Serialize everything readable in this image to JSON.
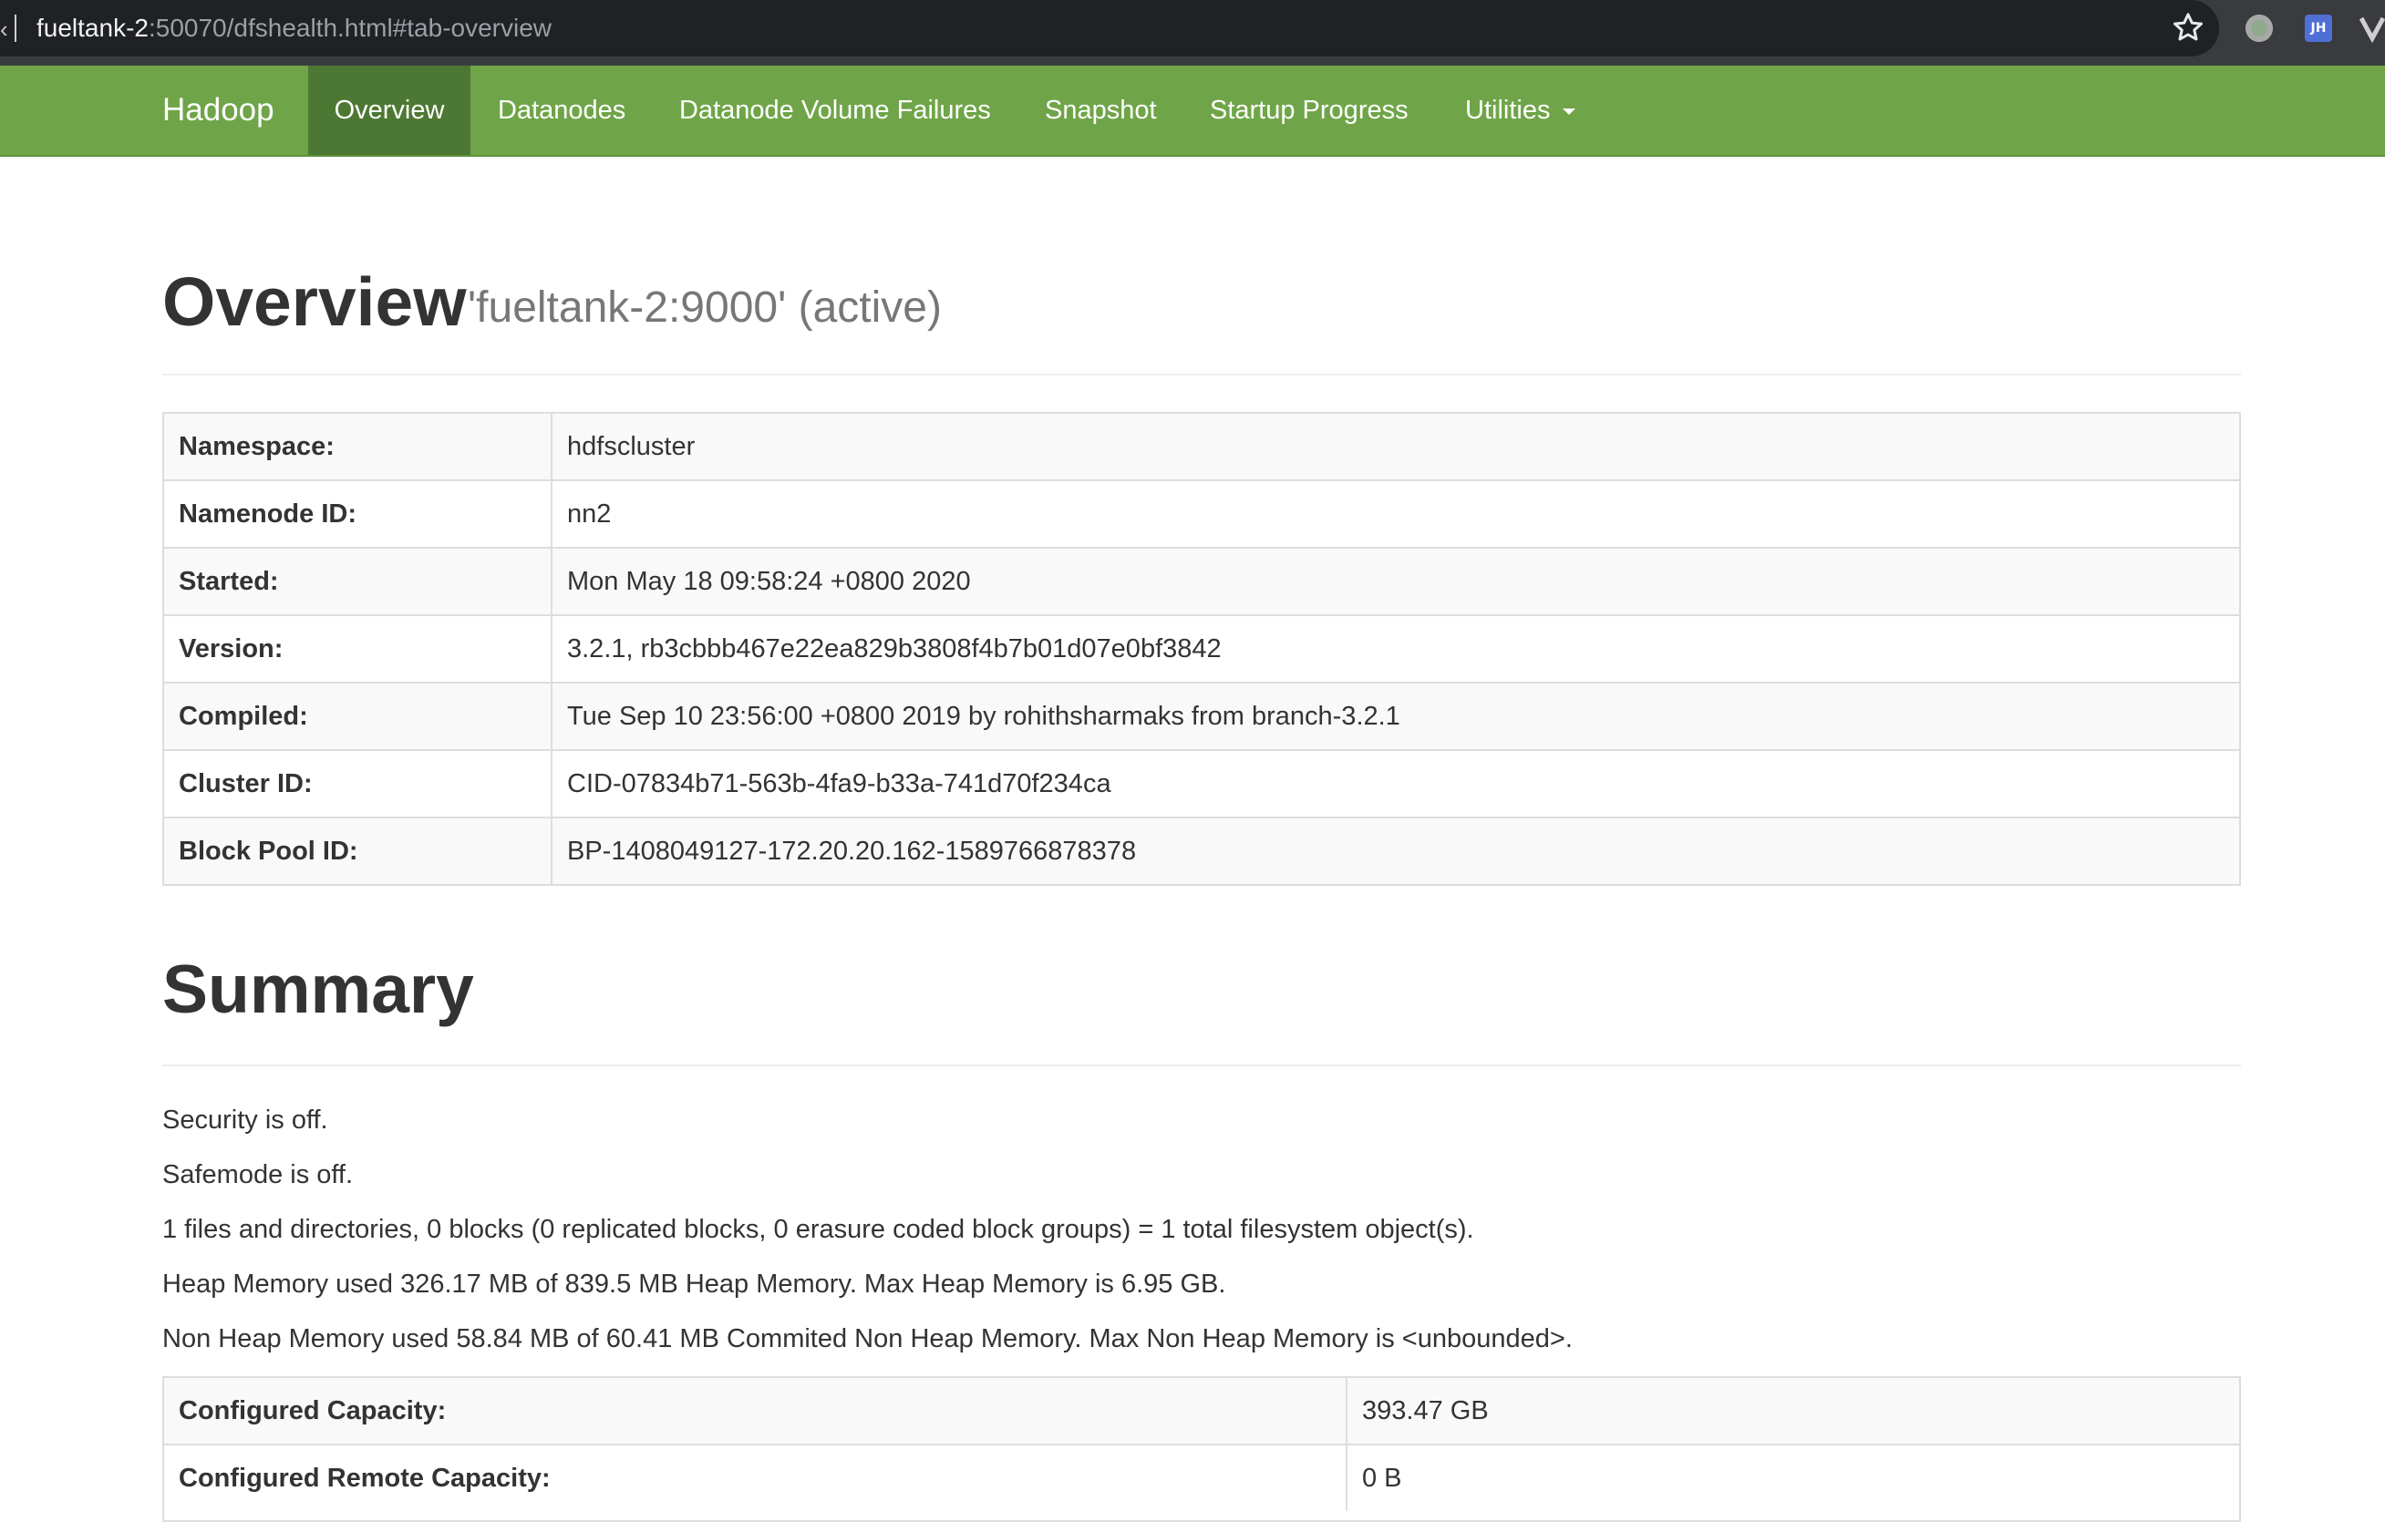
{
  "browser": {
    "url_host": "fueltank-2",
    "url_rest": ":50070/dfshealth.html#tab-overview",
    "icons": [
      "bookmark-star-icon",
      "extension-green-icon",
      "extension-jh-icon",
      "extension-v-icon"
    ],
    "jh_label": "JH"
  },
  "navbar": {
    "brand": "Hadoop",
    "color": "#6fa548",
    "active_color": "#4d7833",
    "items": [
      {
        "label": "Overview",
        "active": true
      },
      {
        "label": "Datanodes"
      },
      {
        "label": "Datanode Volume Failures"
      },
      {
        "label": "Snapshot"
      },
      {
        "label": "Startup Progress"
      },
      {
        "label": "Utilities"
      }
    ]
  },
  "overview": {
    "title": "Overview",
    "subtitle": "'fueltank-2:9000' (active)",
    "rows": [
      {
        "key": "Namespace:",
        "value": "hdfscluster"
      },
      {
        "key": "Namenode ID:",
        "value": "nn2"
      },
      {
        "key": "Started:",
        "value": "Mon May 18 09:58:24 +0800 2020"
      },
      {
        "key": "Version:",
        "value": "3.2.1, rb3cbbb467e22ea829b3808f4b7b01d07e0bf3842"
      },
      {
        "key": "Compiled:",
        "value": "Tue Sep 10 23:56:00 +0800 2019 by rohithsharmaks from branch-3.2.1"
      },
      {
        "key": "Cluster ID:",
        "value": "CID-07834b71-563b-4fa9-b33a-741d70f234ca"
      },
      {
        "key": "Block Pool ID:",
        "value": "BP-1408049127-172.20.20.162-1589766878378"
      }
    ]
  },
  "summary": {
    "title": "Summary",
    "lines": [
      "Security is off.",
      "Safemode is off.",
      "1 files and directories, 0 blocks (0 replicated blocks, 0 erasure coded block groups) = 1 total filesystem object(s).",
      "Heap Memory used 326.17 MB of 839.5 MB Heap Memory. Max Heap Memory is 6.95 GB.",
      "Non Heap Memory used 58.84 MB of 60.41 MB Commited Non Heap Memory. Max Non Heap Memory is <unbounded>."
    ],
    "rows": [
      {
        "key": "Configured Capacity:",
        "value": "393.47 GB"
      },
      {
        "key": "Configured Remote Capacity:",
        "value": "0 B"
      }
    ]
  }
}
